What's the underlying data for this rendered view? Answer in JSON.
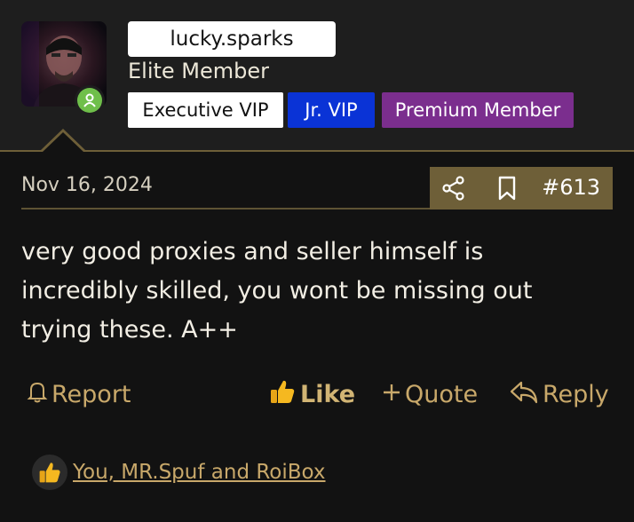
{
  "user": {
    "username": "lucky.sparks",
    "title": "Elite Member",
    "online_icon": "user-icon",
    "badges": [
      "Executive VIP",
      "Jr. VIP",
      "Premium Member"
    ],
    "badge_colors": [
      "#ffffff",
      "#0a33d6",
      "#7b2e8e"
    ]
  },
  "post": {
    "date": "Nov 16, 2024",
    "number": "#613",
    "icons": [
      "share-icon",
      "bookmark-icon"
    ],
    "message": "very good proxies and seller himself is incredibly skilled, you wont be missing out trying these. A++"
  },
  "actions": {
    "report": "Report",
    "like": "Like",
    "quote": "Quote",
    "reply": "Reply"
  },
  "reactions": {
    "icon": "thumbs-up-icon",
    "text": "You, MR.Spuf and RoiBox"
  },
  "colors": {
    "accent": "#6e5f38",
    "link": "#c8a86a",
    "online": "#6fbf4a"
  }
}
